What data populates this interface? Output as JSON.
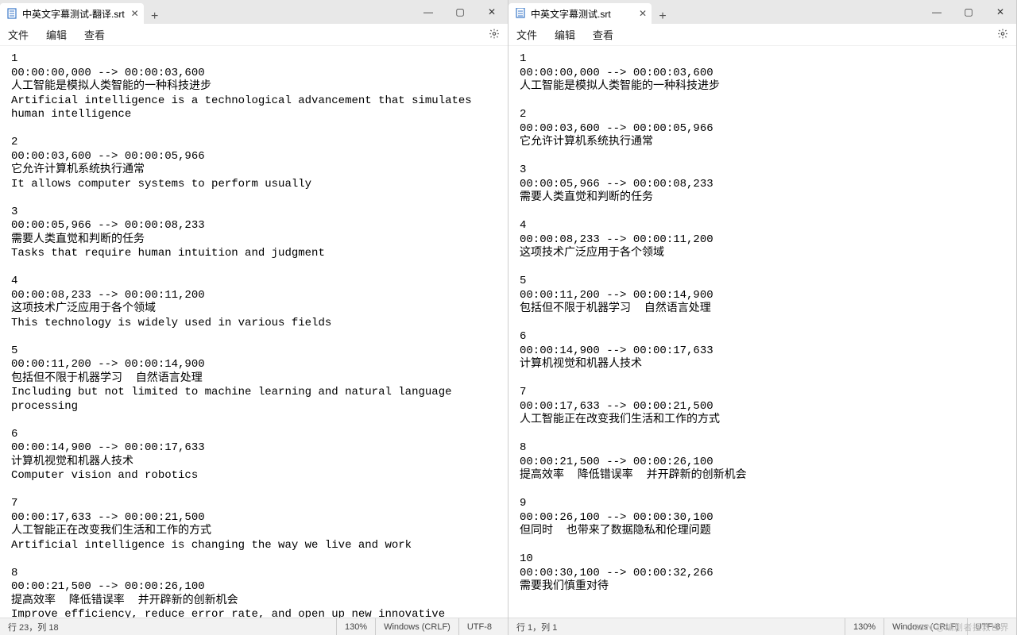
{
  "left": {
    "tab_title": "中英文字幕测试-翻译.srt",
    "menu": {
      "file": "文件",
      "edit": "编辑",
      "view": "查看"
    },
    "content": "1\n00:00:00,000 --> 00:00:03,600\n人工智能是模拟人类智能的一种科技进步\nArtificial intelligence is a technological advancement that simulates human intelligence\n\n2\n00:00:03,600 --> 00:00:05,966\n它允许计算机系统执行通常\nIt allows computer systems to perform usually\n\n3\n00:00:05,966 --> 00:00:08,233\n需要人类直觉和判断的任务\nTasks that require human intuition and judgment\n\n4\n00:00:08,233 --> 00:00:11,200\n这项技术广泛应用于各个领域\nThis technology is widely used in various fields\n\n5\n00:00:11,200 --> 00:00:14,900\n包括但不限于机器学习  自然语言处理\nIncluding but not limited to machine learning and natural language processing\n\n6\n00:00:14,900 --> 00:00:17,633\n计算机视觉和机器人技术\nComputer vision and robotics\n\n7\n00:00:17,633 --> 00:00:21,500\n人工智能正在改变我们生活和工作的方式\nArtificial intelligence is changing the way we live and work\n\n8\n00:00:21,500 --> 00:00:26,100\n提高效率  降低错误率  并开辟新的创新机会\nImprove efficiency, reduce error rate, and open up new innovative",
    "status": {
      "pos": "行 23，列 18",
      "zoom": "130%",
      "eol": "Windows (CRLF)",
      "enc": "UTF-8"
    }
  },
  "right": {
    "tab_title": "中英文字幕测试.srt",
    "menu": {
      "file": "文件",
      "edit": "编辑",
      "view": "查看"
    },
    "content": "1\n00:00:00,000 --> 00:00:03,600\n人工智能是模拟人类智能的一种科技进步\n\n2\n00:00:03,600 --> 00:00:05,966\n它允许计算机系统执行通常\n\n3\n00:00:05,966 --> 00:00:08,233\n需要人类直觉和判断的任务\n\n4\n00:00:08,233 --> 00:00:11,200\n这项技术广泛应用于各个领域\n\n5\n00:00:11,200 --> 00:00:14,900\n包括但不限于机器学习  自然语言处理\n\n6\n00:00:14,900 --> 00:00:17,633\n计算机视觉和机器人技术\n\n7\n00:00:17,633 --> 00:00:21,500\n人工智能正在改变我们生活和工作的方式\n\n8\n00:00:21,500 --> 00:00:26,100\n提高效率  降低错误率  并开辟新的创新机会\n\n9\n00:00:26,100 --> 00:00:30,100\n但同时  也带来了数据隐私和伦理问题\n\n10\n00:00:30,100 --> 00:00:32,266\n需要我们慎重对待",
    "status": {
      "pos": "行 1，列 1",
      "zoom": "130%",
      "eol": "Windows (CRLF)",
      "enc": "UTF-8"
    }
  },
  "watermark": "CSDN @编剧者拯救世界"
}
